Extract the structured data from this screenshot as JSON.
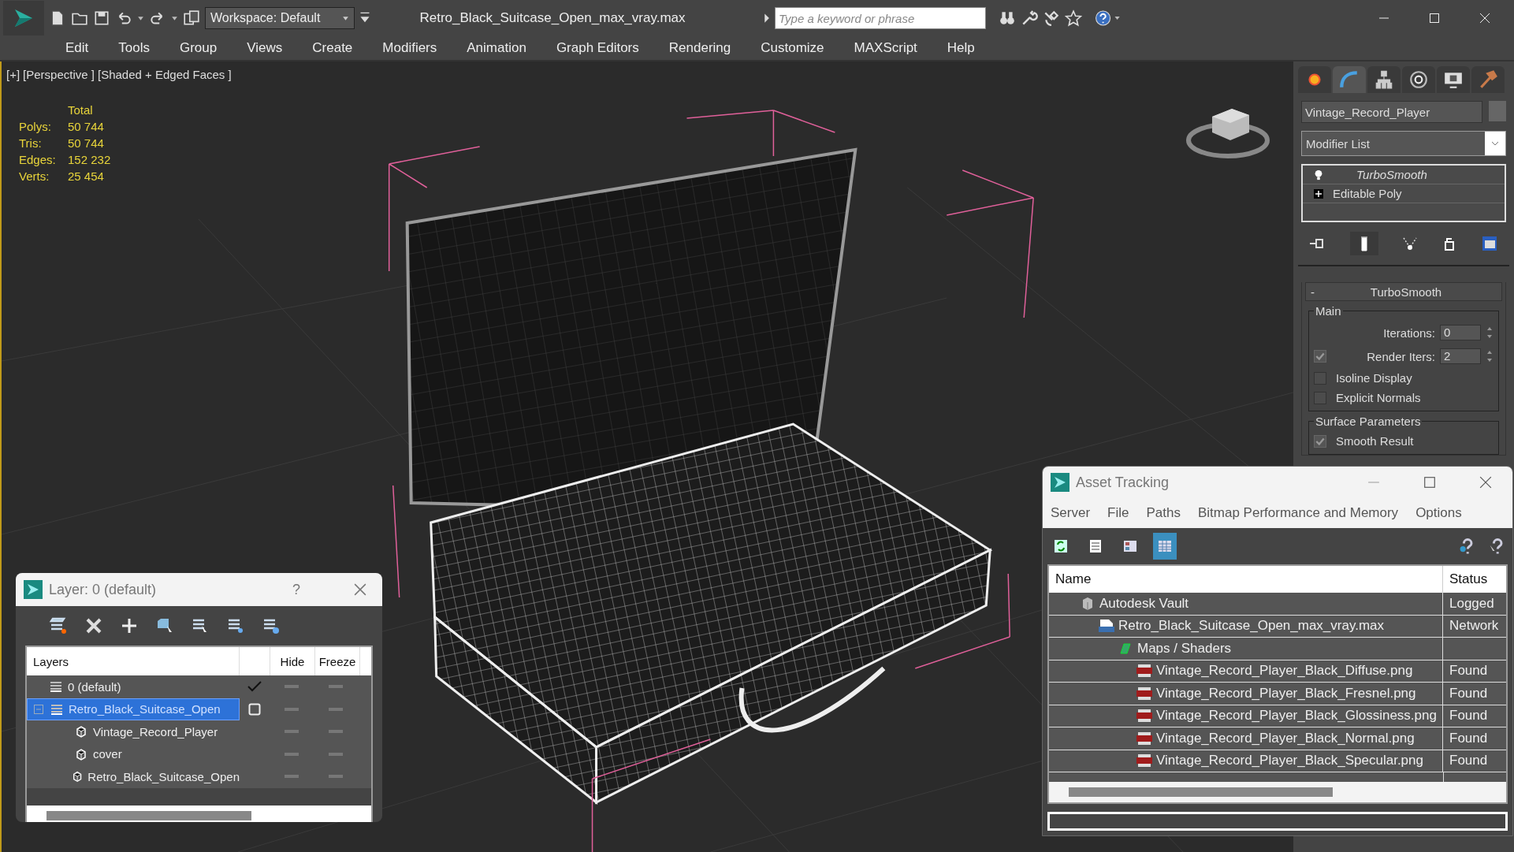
{
  "title_bar": {
    "workspace": "Workspace: Default",
    "title": "Retro_Black_Suitcase_Open_max_vray.max",
    "search": {
      "placeholder": "Type a keyword or phrase"
    }
  },
  "menu": [
    "Edit",
    "Tools",
    "Group",
    "Views",
    "Create",
    "Modifiers",
    "Animation",
    "Graph Editors",
    "Rendering",
    "Customize",
    "MAXScript",
    "Help"
  ],
  "viewport": {
    "labels": [
      "[+]",
      "[Perspective ]",
      "[Shaded + Edged Faces ]"
    ],
    "stats": {
      "header": "Total",
      "rows": [
        {
          "label": "Polys:",
          "value": "50 744"
        },
        {
          "label": "Tris:",
          "value": "50 744"
        },
        {
          "label": "Edges:",
          "value": "152 232"
        },
        {
          "label": "Verts:",
          "value": "25 454"
        }
      ]
    }
  },
  "command_panel": {
    "tabs": [
      {
        "kind": "create",
        "selected": false
      },
      {
        "kind": "modify",
        "selected": true
      },
      {
        "kind": "hierarchy",
        "selected": false
      },
      {
        "kind": "motion",
        "selected": false
      },
      {
        "kind": "display",
        "selected": false
      },
      {
        "kind": "utilities",
        "selected": false
      }
    ],
    "object_name": "Vintage_Record_Player",
    "modifier_list": "Modifier List",
    "stack": [
      {
        "kind": "modifier",
        "label": "TurboSmooth"
      },
      {
        "kind": "base",
        "label": "Editable Poly"
      }
    ],
    "rollout": {
      "title": "TurboSmooth",
      "collapse": "-",
      "group": "Main",
      "spinners": [
        {
          "label": "Iterations:",
          "value": "0"
        },
        {
          "label": "Render Iters:",
          "value": "2",
          "checked": true
        }
      ],
      "checks": [
        {
          "label": "Isoline Display",
          "checked": false
        },
        {
          "label": "Explicit Normals",
          "checked": false
        }
      ],
      "group2": "Surface Parameters",
      "partial_check": {
        "label": "Smooth Result",
        "checked": true
      }
    }
  },
  "layer_dialog": {
    "title": "Layer: 0 (default)",
    "help": "?",
    "columns": [
      "Layers",
      "Hide",
      "Freeze"
    ],
    "rows": [
      {
        "name": "0 (default)",
        "kind": "layer",
        "current": true,
        "selected": false
      },
      {
        "name": "Retro_Black_Suitcase_Open",
        "kind": "layer",
        "current": false,
        "selected": true,
        "expanded": true,
        "children": [
          {
            "name": "Vintage_Record_Player",
            "kind": "object",
            "current": false,
            "selected": false
          },
          {
            "name": "cover",
            "kind": "object",
            "current": false,
            "selected": false
          },
          {
            "name": "Retro_Black_Suitcase_Open",
            "kind": "object",
            "current": false,
            "selected": false
          }
        ]
      }
    ]
  },
  "asset_tracking": {
    "title": "Asset Tracking",
    "menu": [
      "Server",
      "File",
      "Paths",
      "Bitmap Performance and Memory",
      "Options"
    ],
    "tools": [
      {
        "kind": "refresh",
        "selected": false
      },
      {
        "kind": "list",
        "selected": false
      },
      {
        "kind": "thumbnails",
        "selected": false
      },
      {
        "kind": "table",
        "selected": true
      }
    ],
    "columns": [
      "Name",
      "Status"
    ],
    "rows": [
      {
        "kind": "vault",
        "name": "Autodesk Vault",
        "status": "Logged",
        "children": [
          {
            "kind": "maxfile",
            "name": "Retro_Black_Suitcase_Open_max_vray.max",
            "status": "Network",
            "children": [
              {
                "kind": "folder",
                "name": "Maps / Shaders",
                "children": [
                  {
                    "kind": "png",
                    "name": "Vintage_Record_Player_Black_Diffuse.png",
                    "status": "Found"
                  },
                  {
                    "kind": "png",
                    "name": "Vintage_Record_Player_Black_Fresnel.png",
                    "status": "Found"
                  },
                  {
                    "kind": "png",
                    "name": "Vintage_Record_Player_Black_Glossiness.png",
                    "status": "Found"
                  },
                  {
                    "kind": "png",
                    "name": "Vintage_Record_Player_Black_Normal.png",
                    "status": "Found"
                  },
                  {
                    "kind": "png",
                    "name": "Vintage_Record_Player_Black_Specular.png",
                    "status": "Found"
                  }
                ]
              }
            ]
          }
        ]
      }
    ]
  }
}
